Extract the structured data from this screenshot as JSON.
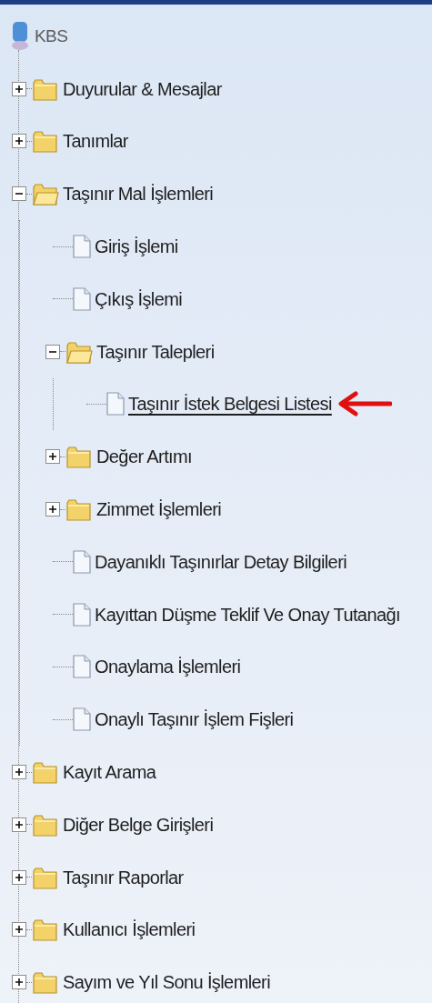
{
  "tree": {
    "root": {
      "label": "KBS"
    },
    "nodes": [
      {
        "kind": "folder",
        "label": "Duyurular & Mesajlar",
        "expanded": false,
        "selected": false
      },
      {
        "kind": "folder",
        "label": "Tanımlar",
        "expanded": false,
        "selected": false
      },
      {
        "kind": "folder",
        "label": "Taşınır Mal İşlemleri",
        "expanded": true,
        "selected": false,
        "children": [
          {
            "kind": "document",
            "label": "Giriş İşlemi",
            "selected": false
          },
          {
            "kind": "document",
            "label": "Çıkış İşlemi",
            "selected": false
          },
          {
            "kind": "folder",
            "label": "Taşınır Talepleri",
            "expanded": true,
            "selected": false,
            "children": [
              {
                "kind": "document",
                "label": "Taşınır İstek Belgesi Listesi",
                "selected": true
              }
            ]
          },
          {
            "kind": "folder",
            "label": "Değer Artımı",
            "expanded": false,
            "selected": false
          },
          {
            "kind": "folder",
            "label": "Zimmet İşlemleri",
            "expanded": false,
            "selected": false
          },
          {
            "kind": "document",
            "label": "Dayanıklı Taşınırlar Detay Bilgileri",
            "selected": false
          },
          {
            "kind": "document",
            "label": "Kayıttan Düşme Teklif Ve Onay Tutanağı",
            "selected": false
          },
          {
            "kind": "document",
            "label": "Onaylama İşlemleri",
            "selected": false
          },
          {
            "kind": "document",
            "label": "Onaylı Taşınır İşlem Fişleri",
            "selected": false
          }
        ]
      },
      {
        "kind": "folder",
        "label": "Kayıt Arama",
        "expanded": false,
        "selected": false
      },
      {
        "kind": "folder",
        "label": "Diğer Belge Girişleri",
        "expanded": false,
        "selected": false
      },
      {
        "kind": "folder",
        "label": "Taşınır Raporlar",
        "expanded": false,
        "selected": false
      },
      {
        "kind": "folder",
        "label": "Kullanıcı İşlemleri",
        "expanded": false,
        "selected": false
      },
      {
        "kind": "folder",
        "label": "Sayım ve Yıl Sonu İşlemleri",
        "expanded": false,
        "selected": false
      }
    ]
  }
}
